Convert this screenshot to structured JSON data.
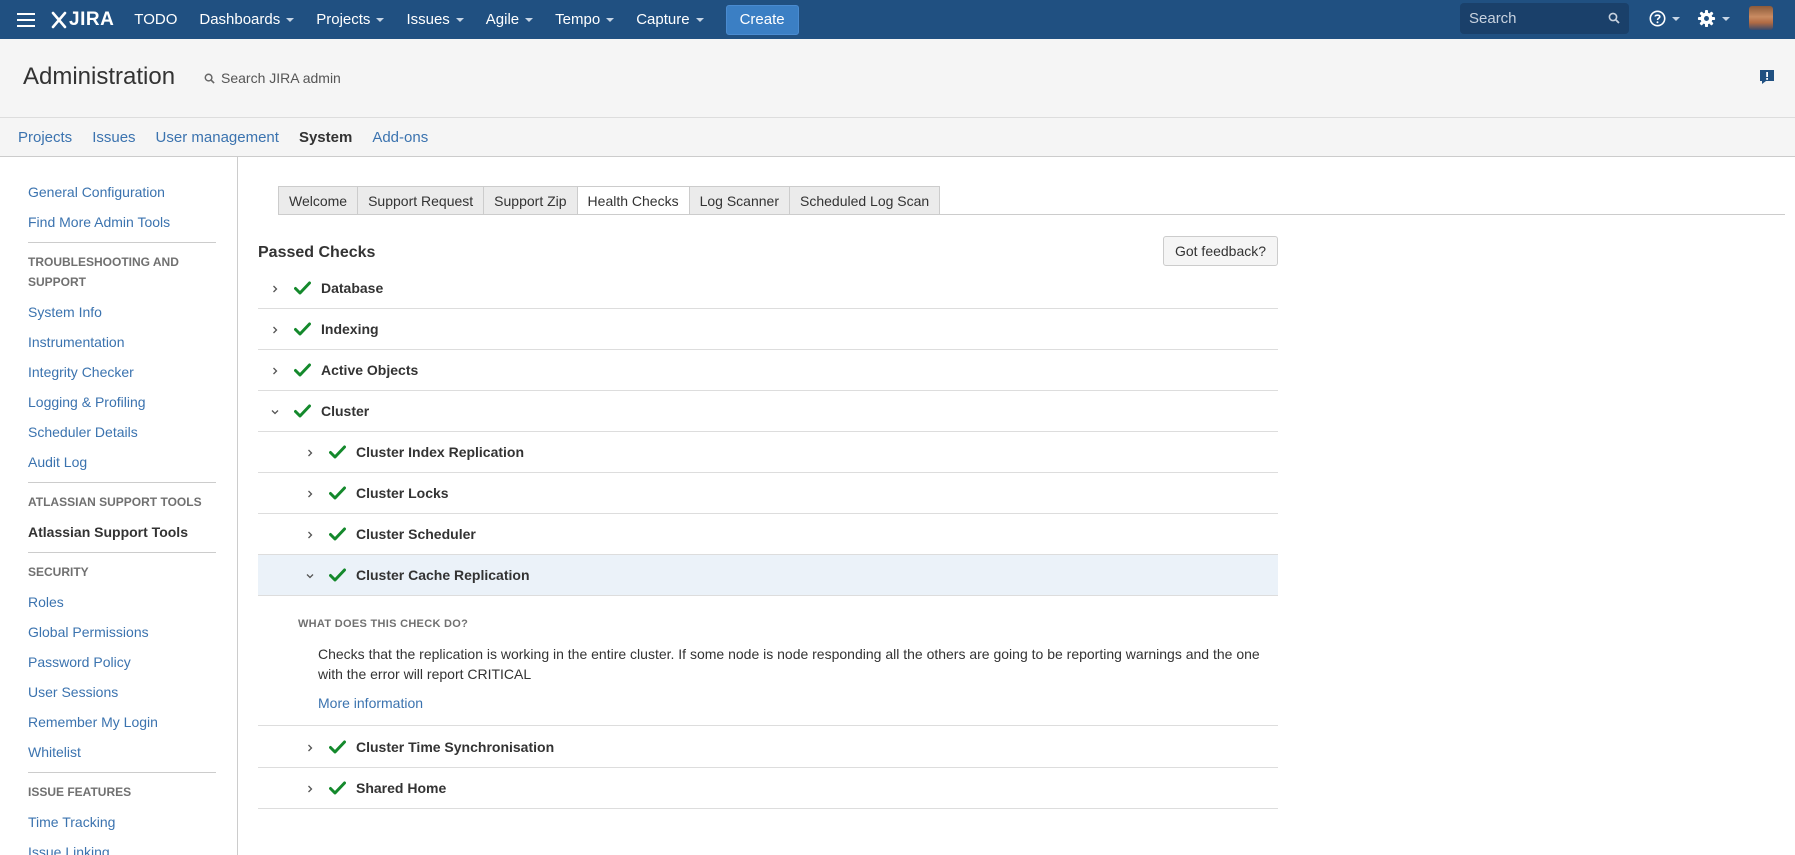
{
  "topnav": {
    "logo": "JIRA",
    "items": [
      {
        "label": "TODO",
        "dropdown": false
      },
      {
        "label": "Dashboards",
        "dropdown": true
      },
      {
        "label": "Projects",
        "dropdown": true
      },
      {
        "label": "Issues",
        "dropdown": true
      },
      {
        "label": "Agile",
        "dropdown": true
      },
      {
        "label": "Tempo",
        "dropdown": true
      },
      {
        "label": "Capture",
        "dropdown": true
      }
    ],
    "create_label": "Create",
    "search_placeholder": "Search",
    "icons": [
      "menu-icon",
      "help-icon",
      "gear-icon",
      "avatar"
    ],
    "bar_color": "#205081"
  },
  "admin": {
    "title": "Administration",
    "search_placeholder": "Search JIRA admin",
    "tabs": [
      "Projects",
      "Issues",
      "User management",
      "System",
      "Add-ons"
    ],
    "active_tab": "System"
  },
  "sidebar": {
    "link1": "General Configuration",
    "link2": "Find More Admin Tools",
    "section_troubleshooting": "TROUBLESHOOTING AND SUPPORT",
    "troubleshooting": [
      "System Info",
      "Instrumentation",
      "Integrity Checker",
      "Logging & Profiling",
      "Scheduler Details",
      "Audit Log"
    ],
    "section_atlassian": "ATLASSIAN SUPPORT TOOLS",
    "atlassian_current": "Atlassian Support Tools",
    "section_security": "SECURITY",
    "security": [
      "Roles",
      "Global Permissions",
      "Password Policy",
      "User Sessions",
      "Remember My Login",
      "Whitelist"
    ],
    "section_issue_features": "ISSUE FEATURES",
    "issue_features": [
      "Time Tracking",
      "Issue Linking"
    ]
  },
  "main": {
    "subtabs": [
      "Welcome",
      "Support Request",
      "Support Zip",
      "Health Checks",
      "Log Scanner",
      "Scheduled Log Scan"
    ],
    "active_subtab": "Health Checks",
    "passed_title": "Passed Checks",
    "feedback_label": "Got feedback?",
    "checks": [
      {
        "label": "Database",
        "expanded": false,
        "level": 0,
        "status": "passed"
      },
      {
        "label": "Indexing",
        "expanded": false,
        "level": 0,
        "status": "passed"
      },
      {
        "label": "Active Objects",
        "expanded": false,
        "level": 0,
        "status": "passed"
      },
      {
        "label": "Cluster",
        "expanded": true,
        "level": 0,
        "status": "passed"
      },
      {
        "label": "Cluster Index Replication",
        "expanded": false,
        "level": 1,
        "status": "passed"
      },
      {
        "label": "Cluster Locks",
        "expanded": false,
        "level": 1,
        "status": "passed"
      },
      {
        "label": "Cluster Scheduler",
        "expanded": false,
        "level": 1,
        "status": "passed"
      },
      {
        "label": "Cluster Cache Replication",
        "expanded": true,
        "level": 1,
        "status": "passed",
        "selected": true
      },
      {
        "label": "Cluster Time Synchronisation",
        "expanded": false,
        "level": 1,
        "status": "passed"
      },
      {
        "label": "Shared Home",
        "expanded": false,
        "level": 1,
        "status": "passed"
      }
    ],
    "detail": {
      "heading": "WHAT DOES THIS CHECK DO?",
      "text": "Checks that the replication is working in the entire cluster. If some node is node responding all the others are going to be reporting warnings and the one with the error will report CRITICAL",
      "link": "More information"
    },
    "check_color": "#14892c"
  }
}
